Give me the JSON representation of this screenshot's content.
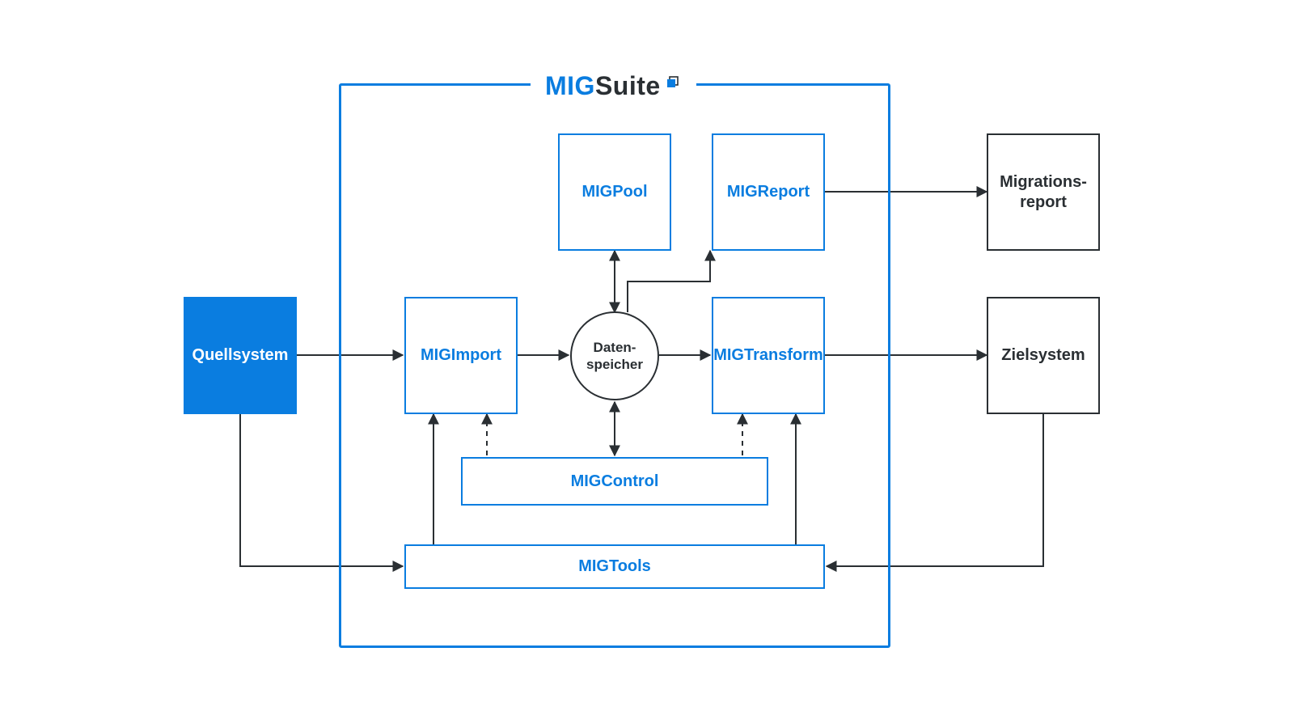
{
  "suite": {
    "title_part1": "MIG",
    "title_part2": "Suite"
  },
  "nodes": {
    "quellsystem": "Quellsystem",
    "zielsystem": "Zielsystem",
    "migrationsreport_l1": "Migrations-",
    "migrationsreport_l2": "report",
    "migpool": "MIGPool",
    "migreport": "MIGReport",
    "migimport": "MIGImport",
    "migtransform": "MIGTransform",
    "datenspeicher_l1": "Daten-",
    "datenspeicher_l2": "speicher",
    "migcontrol": "MIGControl",
    "migtools": "MIGTools"
  }
}
